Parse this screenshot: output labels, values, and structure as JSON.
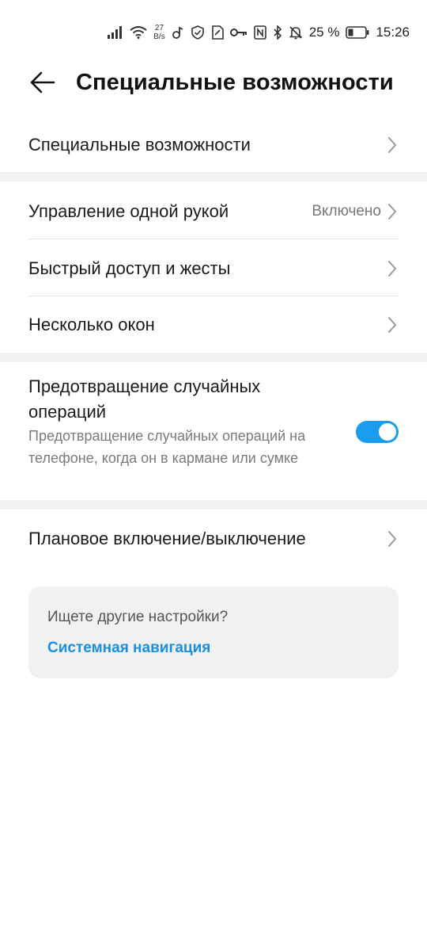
{
  "status_bar": {
    "net_speed_value": "27",
    "net_speed_unit": "B/s",
    "battery_percent": "25 %",
    "time": "15:26",
    "icons": [
      "signal-icon",
      "wifi-icon",
      "music-icon",
      "shield-icon",
      "sim-icon",
      "key-icon",
      "nfc-icon",
      "bluetooth-icon",
      "bell-off-icon",
      "battery-icon"
    ]
  },
  "header": {
    "title": "Специальные возможности",
    "back_icon": "arrow-left-icon"
  },
  "items": {
    "accessibility": {
      "label": "Специальные возможности"
    },
    "one_hand": {
      "label": "Управление одной рукой",
      "value": "Включено"
    },
    "quick_access": {
      "label": "Быстрый доступ и жесты"
    },
    "multi_window": {
      "label": "Несколько окон"
    },
    "accidental": {
      "title": "Предотвращение случайных операций",
      "description": "Предотвращение случайных операций на телефоне, когда он в кармане или сумке",
      "enabled": true
    },
    "scheduled": {
      "label": "Плановое включение/выключение"
    }
  },
  "suggestion": {
    "question": "Ищете другие настройки?",
    "link": "Системная навигация"
  },
  "colors": {
    "accent": "#1a9cf0",
    "link": "#1a8fe0",
    "section_gap": "#f2f2f2",
    "card_bg": "#f1f1f1"
  }
}
